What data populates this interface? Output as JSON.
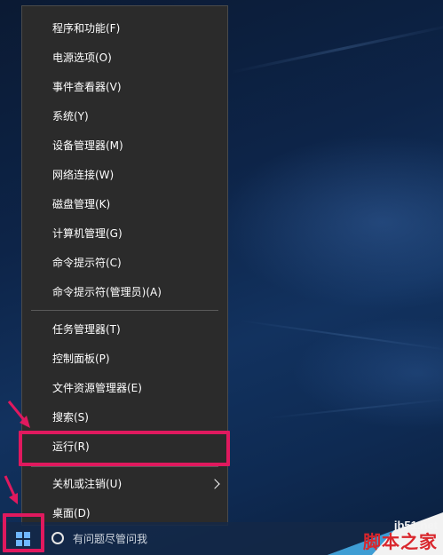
{
  "menu": {
    "items": [
      {
        "label": "程序和功能(F)"
      },
      {
        "label": "电源选项(O)"
      },
      {
        "label": "事件查看器(V)"
      },
      {
        "label": "系统(Y)"
      },
      {
        "label": "设备管理器(M)"
      },
      {
        "label": "网络连接(W)"
      },
      {
        "label": "磁盘管理(K)"
      },
      {
        "label": "计算机管理(G)"
      },
      {
        "label": "命令提示符(C)"
      },
      {
        "label": "命令提示符(管理员)(A)"
      },
      {
        "label": "任务管理器(T)"
      },
      {
        "label": "控制面板(P)"
      },
      {
        "label": "文件资源管理器(E)"
      },
      {
        "label": "搜索(S)"
      },
      {
        "label": "运行(R)"
      },
      {
        "label": "关机或注销(U)"
      },
      {
        "label": "桌面(D)"
      }
    ]
  },
  "taskbar": {
    "search_text": "有问题尽管问我",
    "start_icon": "windows-logo-icon"
  },
  "watermark": {
    "url": "jb51.net",
    "name": "脚本之家"
  },
  "colors": {
    "menu_bg": "#2b2b2b",
    "highlight": "#e0195e",
    "windows_blue": "#6fb7ff"
  }
}
